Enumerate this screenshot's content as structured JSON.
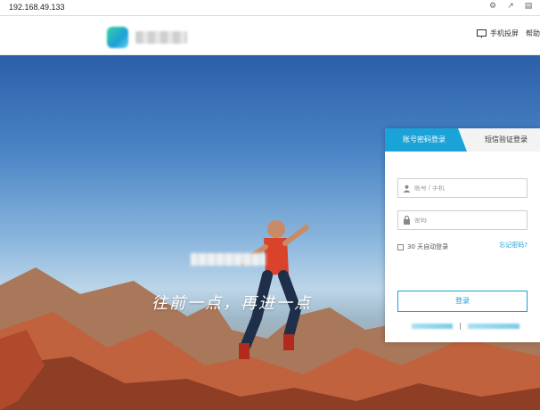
{
  "browser": {
    "url": "192.168.49.133",
    "icons": [
      "security-icon",
      "share-icon",
      "reader-icon"
    ]
  },
  "header": {
    "nav": {
      "cast_label": "手机投屏",
      "help_label": "帮助"
    }
  },
  "hero": {
    "slogan": "往前一点，再进一点"
  },
  "login": {
    "tab_password": "账号密码登录",
    "tab_sms": "短信验证登录",
    "username_placeholder": "账号 / 手机",
    "password_placeholder": "密码",
    "remember_label": "30 天自动登录",
    "forgot_label": "忘记密码?",
    "submit_label": "登录"
  },
  "colors": {
    "accent": "#1aa3d8",
    "panel_bg": "#ffffff"
  }
}
